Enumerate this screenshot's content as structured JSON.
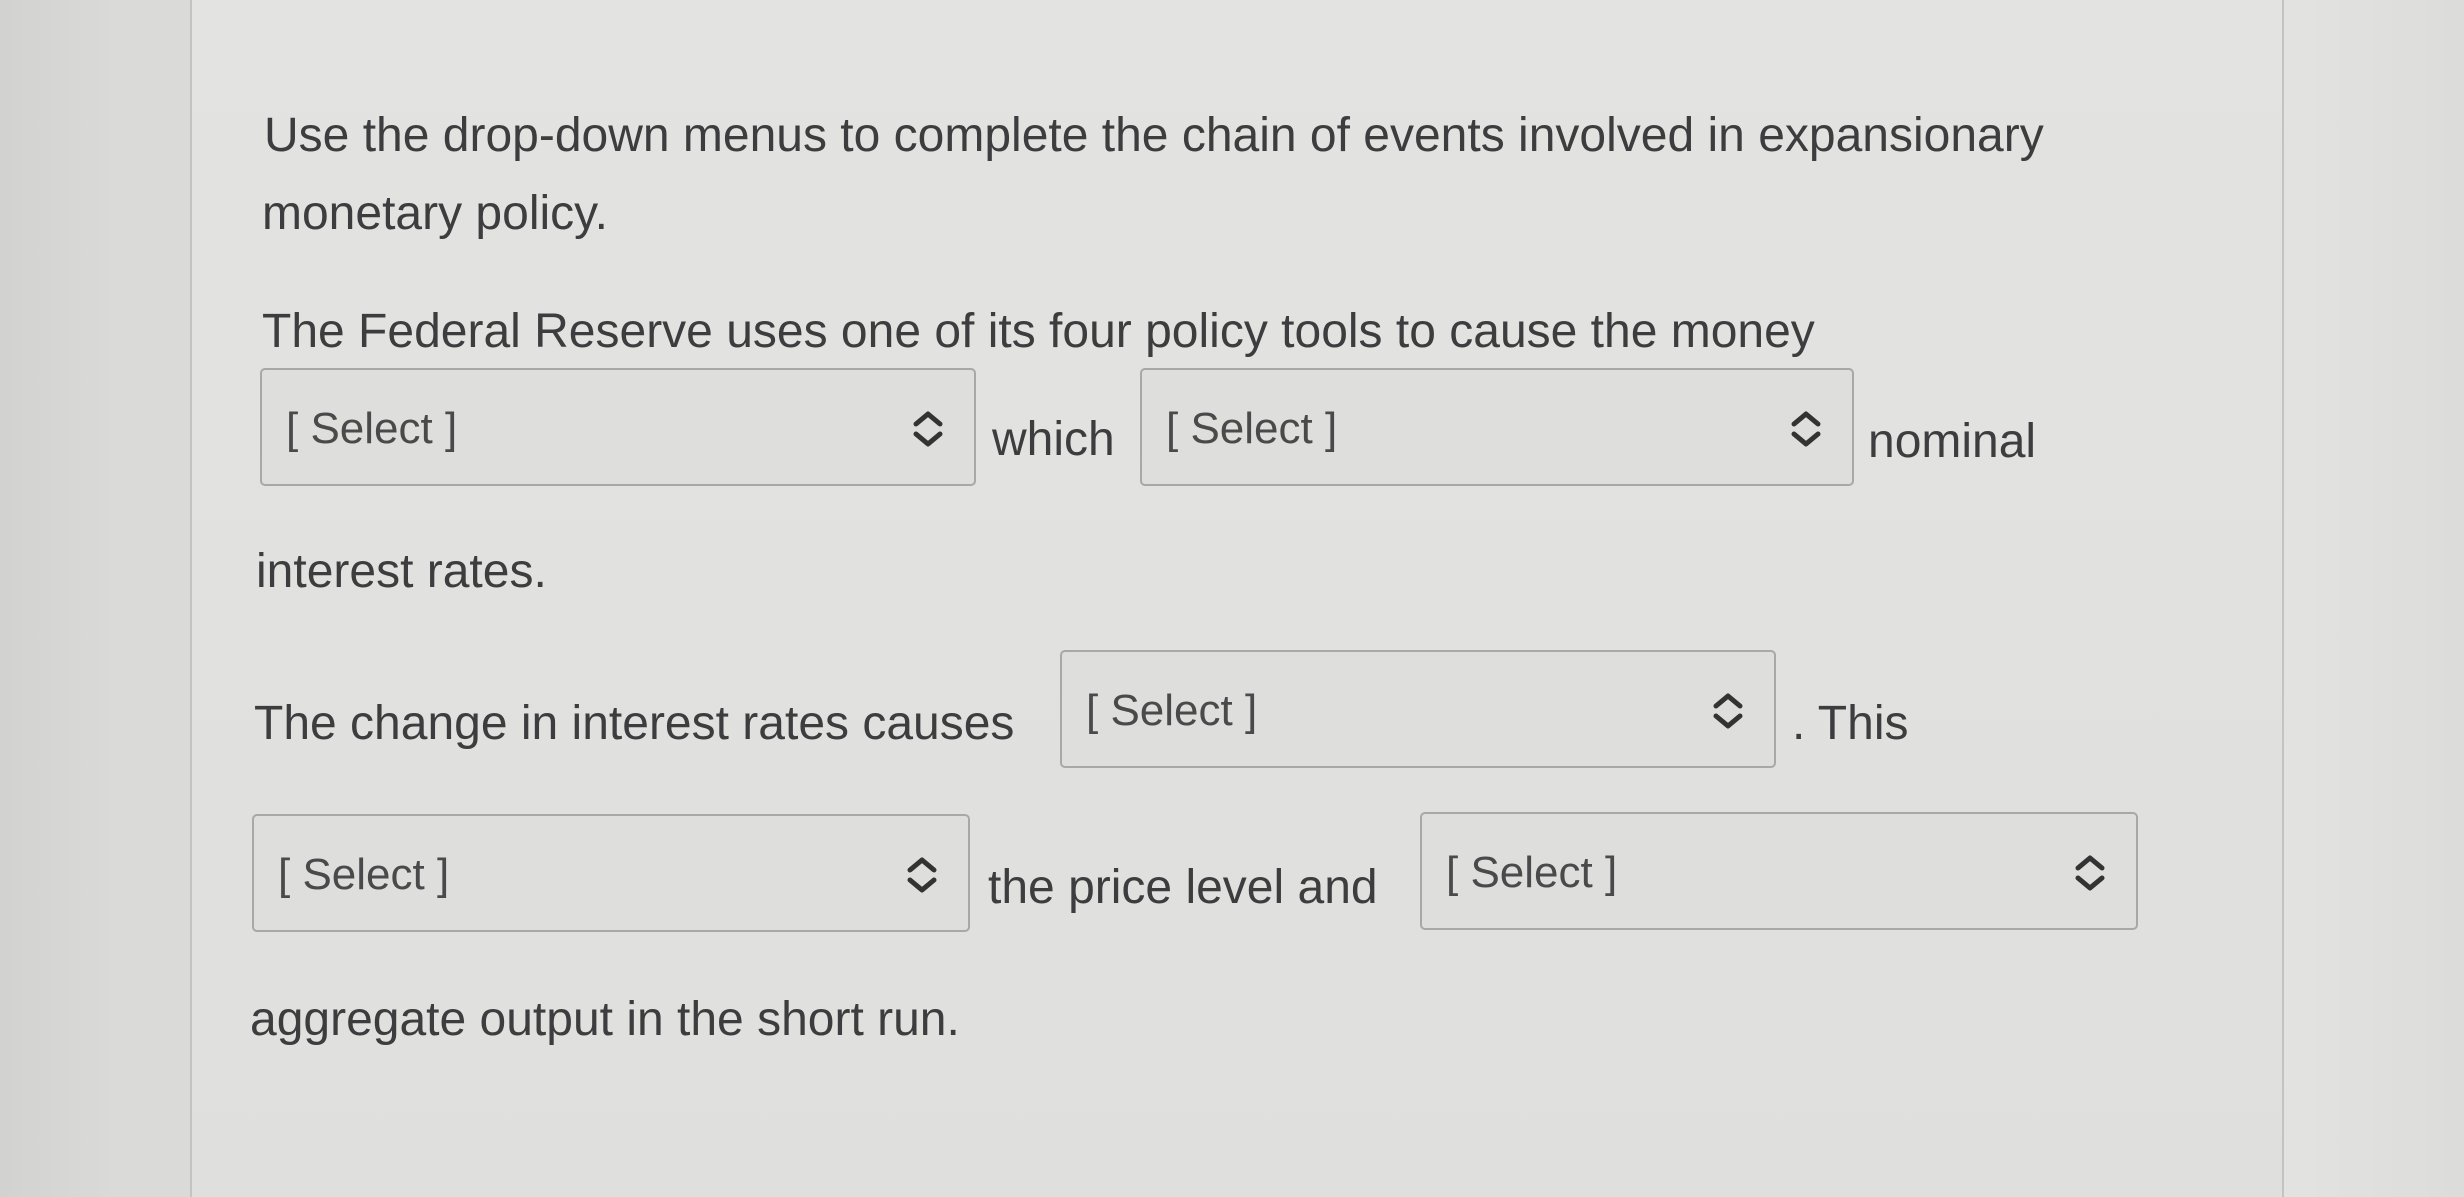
{
  "instruction": {
    "line1": "Use the drop-down menus to complete the chain of events involved in expansionary",
    "line2": "monetary policy."
  },
  "sentence1": {
    "lead": "The Federal Reserve uses one of its four policy tools to cause the money",
    "connector": "which",
    "tail": "nominal",
    "end": "interest rates."
  },
  "sentence2": {
    "lead": "The change in interest rates causes",
    "tail": ". This"
  },
  "sentence3": {
    "connector": "the price level and",
    "end": "aggregate output in the short run."
  },
  "dropdowns": [
    {
      "selected": "[ Select ]",
      "icon": "up-down-chevron-icon"
    },
    {
      "selected": "[ Select ]",
      "icon": "up-down-chevron-icon"
    },
    {
      "selected": "[ Select ]",
      "icon": "up-down-chevron-icon"
    },
    {
      "selected": "[ Select ]",
      "icon": "up-down-chevron-icon"
    },
    {
      "selected": "[ Select ]",
      "icon": "up-down-chevron-icon"
    }
  ]
}
